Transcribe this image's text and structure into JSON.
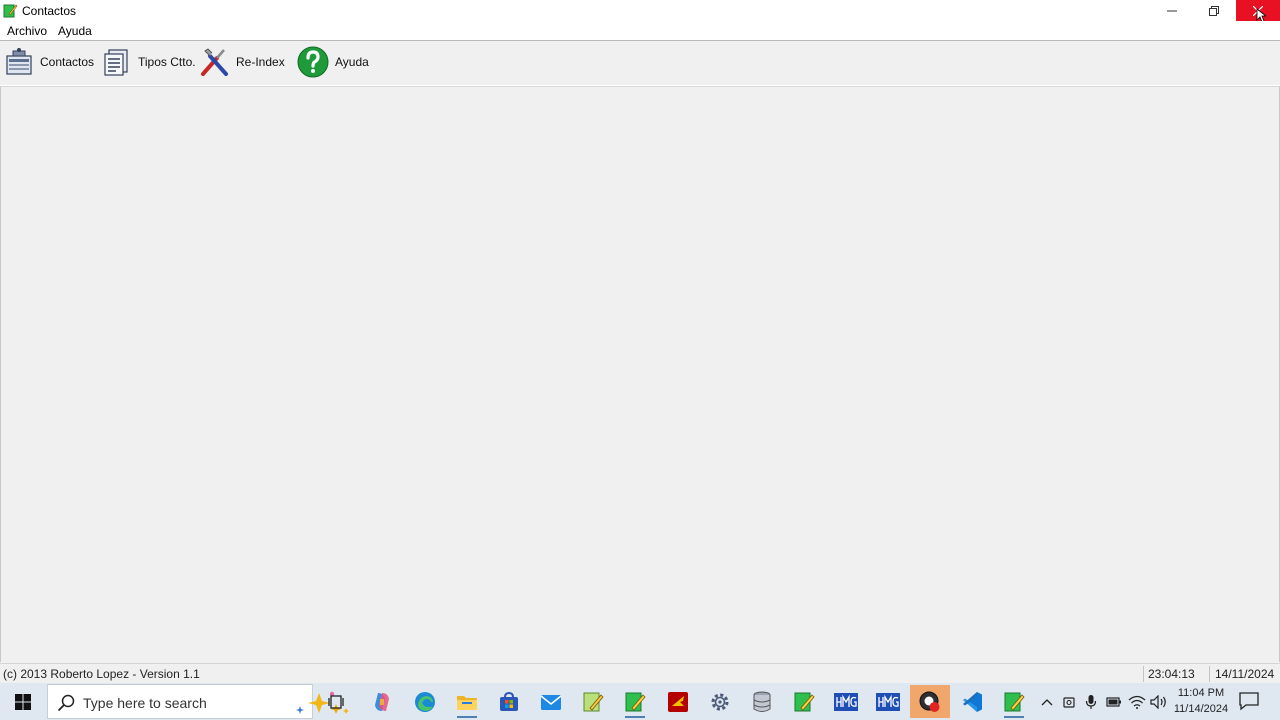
{
  "window": {
    "title": "Contactos",
    "app_icon": "notepad-pencil-icon"
  },
  "title_controls": [
    "minimize-icon",
    "restore-icon",
    "close-icon"
  ],
  "menu": {
    "items": [
      {
        "label": "Archivo"
      },
      {
        "label": "Ayuda"
      }
    ]
  },
  "toolbar": {
    "buttons": [
      {
        "label": "Contactos",
        "icon": "address-book-icon"
      },
      {
        "label": "Tipos Ctto.",
        "icon": "document-list-icon"
      },
      {
        "label": "Re-Index",
        "icon": "tools-icon"
      },
      {
        "label": "Ayuda",
        "icon": "help-question-icon"
      }
    ]
  },
  "status": {
    "text": "(c) 2013 Roberto Lopez - Version 1.1",
    "time": "23:04:13",
    "date": "14/11/2024"
  },
  "taskbar": {
    "search_placeholder": "Type here to search",
    "apps": [
      "task-view-icon",
      "copilot-icon",
      "edge-icon",
      "file-explorer-icon",
      "store-icon",
      "mail-icon",
      "notepad-app-icon",
      "notepad-app-2-icon",
      "filezilla-icon",
      "settings-gear-icon",
      "database-icon",
      "notepad-app-3-icon",
      "hmg-icon",
      "hmg-2-icon",
      "obs-record-icon",
      "vscode-icon",
      "contactos-app-icon"
    ],
    "active_app": "obs-record-icon",
    "clock": {
      "time": "11:04 PM",
      "date": "11/14/2024"
    }
  },
  "colors": {
    "close_hover": "#e81123",
    "taskbar_bg": "#dfe8f1",
    "active_app": "#f1a66b"
  }
}
